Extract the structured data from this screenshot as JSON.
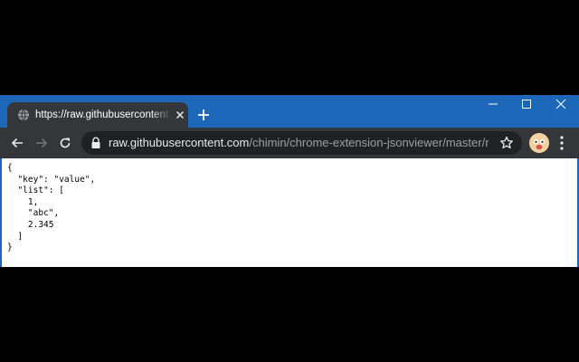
{
  "tab": {
    "title": "https://raw.githubusercontent.com/chimin/chrome-extension-jsonviewer/master/res/sample.json"
  },
  "omnibox": {
    "host": "raw.githubusercontent.com",
    "path": "/chimin/chrome-extension-jsonviewer/master/res/sa..."
  },
  "content": {
    "raw_json": "{\n  \"key\": \"value\",\n  \"list\": [\n    1,\n    \"abc\",\n    2.345\n  ]\n}"
  },
  "colors": {
    "titlebar": "#1d67b9",
    "toolbar": "#35363a",
    "omnibox": "#202124",
    "page_background": "#ffffff"
  },
  "icons": [
    "globe-icon",
    "close-icon",
    "plus-icon",
    "minimize-icon",
    "maximize-icon",
    "close-window-icon",
    "back-arrow-icon",
    "forward-arrow-icon",
    "reload-icon",
    "lock-icon",
    "star-icon",
    "avatar-icon",
    "menu-icon"
  ]
}
